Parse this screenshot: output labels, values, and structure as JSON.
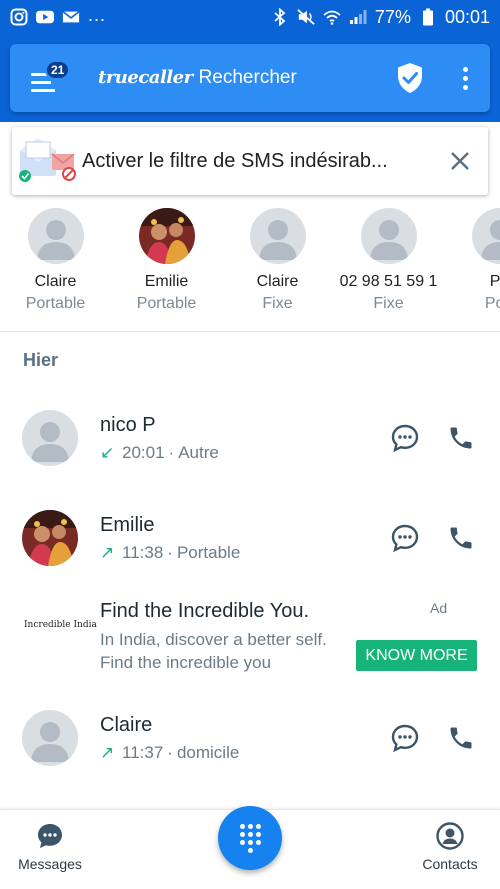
{
  "status_bar": {
    "battery": "77%",
    "time": "00:01",
    "left_icons": [
      "instagram-icon",
      "youtube-icon",
      "mail-icon"
    ],
    "right_icons": [
      "bluetooth-icon",
      "mute-icon",
      "wifi-icon",
      "signal-icon",
      "battery-icon"
    ],
    "more": "..."
  },
  "header": {
    "badge_count": "21",
    "brand": "truecaller",
    "title": "Rechercher",
    "color": "#2e8df4"
  },
  "promo": {
    "text": "Activer le filtre de SMS indésirab..."
  },
  "frequent": [
    {
      "name": "Claire",
      "type": "Portable",
      "avatar": "default"
    },
    {
      "name": "Emilie",
      "type": "Portable",
      "avatar": "photo"
    },
    {
      "name": "Claire",
      "type": "Fixe",
      "avatar": "default"
    },
    {
      "name": "02 98 51 59 1",
      "type": "Fixe",
      "avatar": "default"
    },
    {
      "name": "Pa",
      "type": "Port",
      "avatar": "default"
    }
  ],
  "section_title": "Hier",
  "calls": [
    {
      "name": "nico P",
      "direction": "↙",
      "time": "20:01",
      "label": "Autre",
      "avatar": "default"
    },
    {
      "name": "Emilie",
      "direction": "↗",
      "time": "11:38",
      "label": "Portable",
      "avatar": "photo"
    },
    {
      "name": "Claire",
      "direction": "↗",
      "time": "11:37",
      "label": "domicile",
      "avatar": "default"
    }
  ],
  "separator": "·",
  "ad": {
    "logo": "Incredible India",
    "title": "Find the Incredible You.",
    "body": "In India, discover a better self. Find the incredible you",
    "label": "Ad",
    "cta": "KNOW MORE"
  },
  "bottom_nav": {
    "messages": "Messages",
    "contacts": "Contacts"
  },
  "colors": {
    "primary": "#0b64d6",
    "accent_green": "#17b47a",
    "fab": "#1582f0"
  }
}
